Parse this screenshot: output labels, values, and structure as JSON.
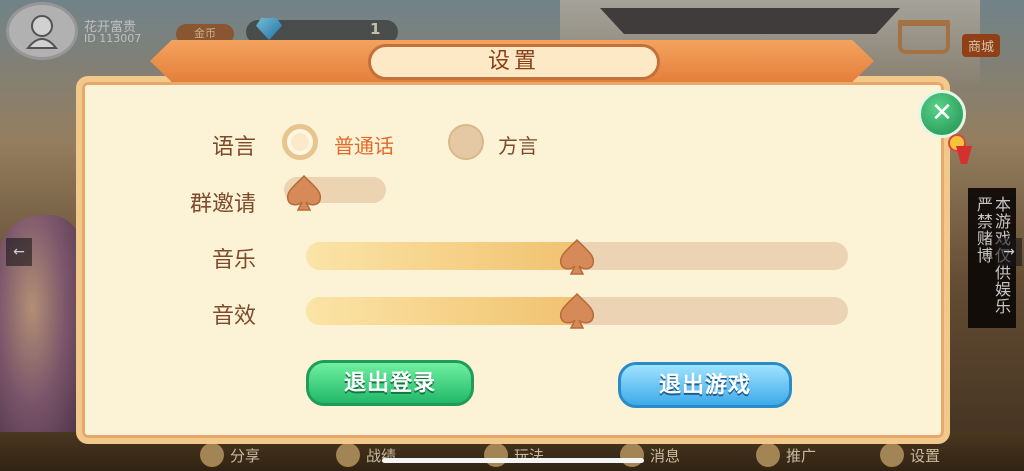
{
  "user": {
    "name": "花开富贵",
    "id": "ID 113007",
    "coin_label": "金币"
  },
  "gems": {
    "count": "1"
  },
  "shop": {
    "label": "商城"
  },
  "side_notice": {
    "col1": "严禁赌博",
    "col2": "本游戏仅供娱乐"
  },
  "dialog": {
    "title": "设置",
    "language": {
      "label": "语言",
      "options": [
        "普通话",
        "方言"
      ],
      "selected": "普通话"
    },
    "group_invite": {
      "label": "群邀请",
      "enabled": false
    },
    "music": {
      "label": "音乐",
      "level": 0.5
    },
    "sound": {
      "label": "音效",
      "level": 0.5
    },
    "logout_label": "退出登录",
    "exit_label": "退出游戏"
  },
  "bottom_nav": [
    "分享",
    "战绩",
    "玩法",
    "消息",
    "推广",
    "设置"
  ],
  "colors": {
    "accent": "#e47f3b",
    "green": "#23b86a",
    "blue": "#3eaae8",
    "panel": "#fcf3d6"
  }
}
